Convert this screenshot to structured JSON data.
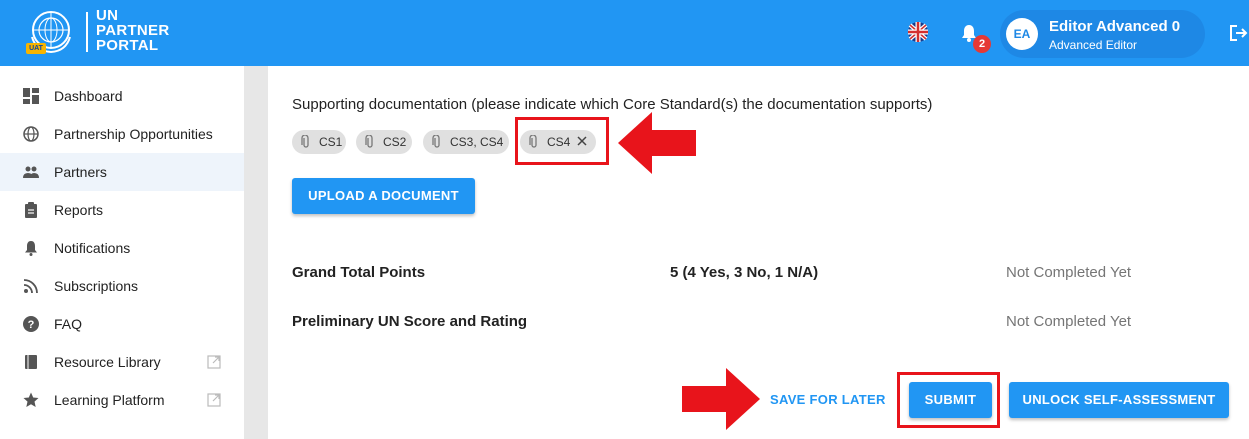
{
  "header": {
    "logo_badge": "UAT",
    "brand_lines": [
      "UN",
      "PARTNER",
      "PORTAL"
    ],
    "notifications_count": "2",
    "user": {
      "initials": "EA",
      "name": "Editor Advanced 0",
      "role": "Advanced Editor"
    }
  },
  "sidebar": {
    "items": [
      {
        "label": "Dashboard",
        "icon": "dashboard-icon"
      },
      {
        "label": "Partnership Opportunities",
        "icon": "globe-icon"
      },
      {
        "label": "Partners",
        "icon": "people-icon",
        "active": true
      },
      {
        "label": "Reports",
        "icon": "clipboard-icon"
      },
      {
        "label": "Notifications",
        "icon": "bell-icon"
      },
      {
        "label": "Subscriptions",
        "icon": "rss-icon"
      },
      {
        "label": "FAQ",
        "icon": "help-icon"
      },
      {
        "label": "Resource Library",
        "icon": "book-icon",
        "external": true
      },
      {
        "label": "Learning Platform",
        "icon": "star-icon",
        "external": true
      }
    ]
  },
  "main": {
    "doc_heading": "Supporting documentation (please indicate which Core Standard(s) the documentation supports)",
    "chips": [
      "CS1",
      "CS2",
      "CS3, CS4",
      "CS4"
    ],
    "upload_label": "UPLOAD A DOCUMENT",
    "rows": [
      {
        "label": "Grand Total Points",
        "value": "5 (4 Yes, 3 No, 1 N/A)",
        "status": "Not Completed Yet"
      },
      {
        "label": "Preliminary UN Score and Rating",
        "value": "",
        "status": "Not Completed Yet"
      }
    ],
    "actions": {
      "save_later": "SAVE FOR LATER",
      "submit": "SUBMIT",
      "unlock": "UNLOCK SELF-ASSESSMENT"
    }
  },
  "colors": {
    "primary": "#2196f3",
    "annotation": "#e8141b",
    "badge": "#e53935"
  }
}
